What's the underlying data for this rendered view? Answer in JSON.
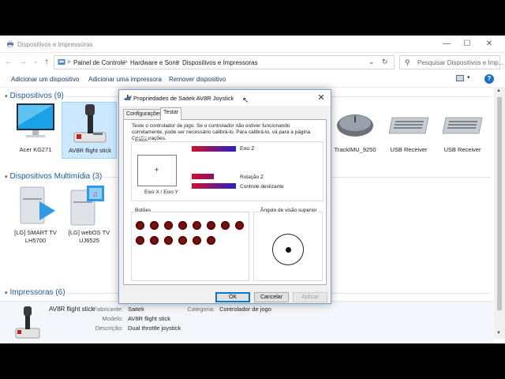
{
  "window": {
    "title": "Dispositivos e Impressoras",
    "min": "—",
    "max": "☐",
    "close": "✕"
  },
  "address": {
    "crumbs": [
      "Painel de Controle",
      "Hardware e Sons",
      "Dispositivos e Impressoras"
    ],
    "separator": ">",
    "search_placeholder": "Pesquisar Dispositivos e Imp..."
  },
  "commands": {
    "add_device": "Adicionar um dispositivo",
    "add_printer": "Adicionar uma impressora",
    "remove_device": "Remover dispositivo"
  },
  "groups": {
    "devices": "Dispositivos (9)",
    "multimedia": "Dispositivos Multimídia (3)",
    "printers": "Impressoras (6)"
  },
  "devices": [
    {
      "label": "Acer KG271"
    },
    {
      "label": "AV8R flight stick"
    },
    {
      "label": "TrackIMU_9250"
    },
    {
      "label": "USB Receiver"
    },
    {
      "label": "USB Receiver"
    }
  ],
  "multimedia": [
    {
      "label": "[LG] SMART TV LH5700"
    },
    {
      "label": "[LG] webOS TV UJ6525"
    }
  ],
  "details": {
    "name": "AV8R flight stick",
    "k_manufacturer": "Fabricante:",
    "v_manufacturer": "Saitek",
    "k_model": "Modelo:",
    "v_model": "AV8R flight stick",
    "k_description": "Descrição:",
    "v_description": "Dual throttle joystick",
    "k_category": "Categoria:",
    "v_category": "Controlador de jogo"
  },
  "dialog": {
    "title": "Propriedades de Saitek AV8R Joystick",
    "close": "✕",
    "tabs": [
      "Configurações",
      "Testar"
    ],
    "intro": "Teste o controlador de jogo. Se o controlador não estiver funcionando corretamente, pode ser necessário calibrá-lo. Para calibrá-lo, vá para a página Configurações.",
    "axes_label": "Eixos",
    "xy_label": "Eixo X / Eixo Y",
    "crosshair": "+",
    "axis_z": "Eixo Z",
    "rot_z": "Rotação Z",
    "slider": "Controle deslizante",
    "buttons_label": "Botões",
    "pov_label": "Ângulo de visão superior",
    "ok": "OK",
    "cancel": "Cancelar",
    "apply": "Aplicar"
  },
  "colors": {
    "accent": "#1e5aa8",
    "button_indicator": "#7a1010",
    "bar_start": "#d0102a",
    "bar_end": "#2a1fc8"
  }
}
